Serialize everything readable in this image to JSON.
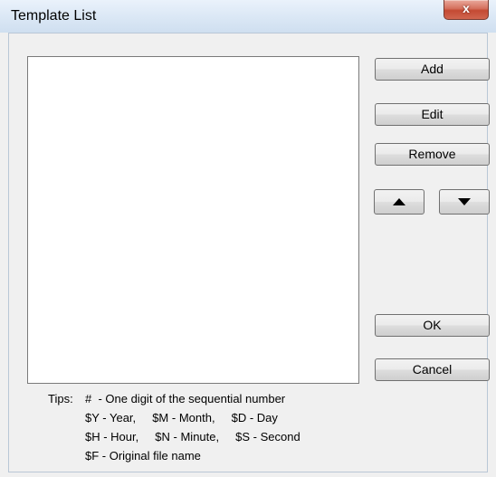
{
  "window": {
    "title": "Template List",
    "close_glyph": "x"
  },
  "buttons": {
    "add": "Add",
    "edit": "Edit",
    "remove": "Remove",
    "move_up_icon": "triangle-up-icon",
    "move_down_icon": "triangle-down-icon",
    "ok": "OK",
    "cancel": "Cancel"
  },
  "template_list": {
    "items": []
  },
  "tips": {
    "label": "Tips:",
    "line1": "#  - One digit of the sequential number",
    "line2": "$Y - Year,     $M - Month,     $D - Day",
    "line3": "$H - Hour,     $N - Minute,     $S - Second",
    "line4": "$F - Original file name"
  },
  "colors": {
    "dialog_background": "#f0f0f0",
    "title_bar": "#dde9f6",
    "close_button": "#c44a33"
  }
}
